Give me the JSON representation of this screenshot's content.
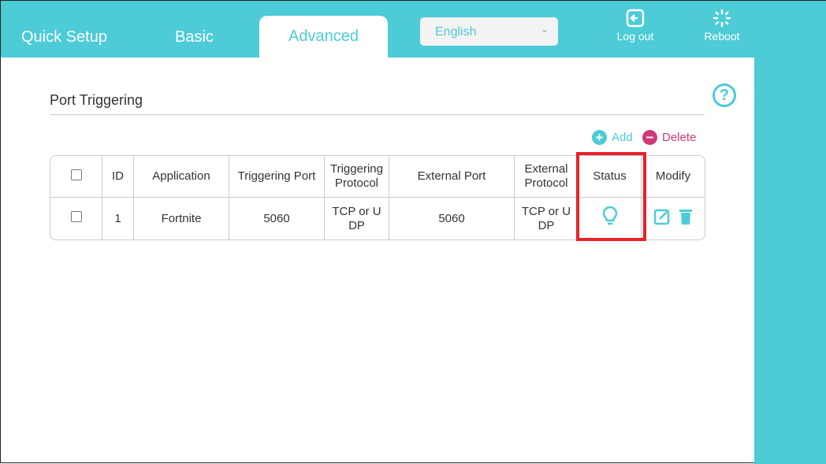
{
  "nav": {
    "quick_setup": "Quick Setup",
    "basic": "Basic",
    "advanced": "Advanced"
  },
  "language": {
    "selected": "English"
  },
  "tools": {
    "logout": "Log out",
    "reboot": "Reboot"
  },
  "page": {
    "title": "Port Triggering",
    "add": "Add",
    "delete": "Delete"
  },
  "table": {
    "headers": [
      "ID",
      "Application",
      "Triggering Port",
      "Triggering Protocol",
      "External Port",
      "External Protocol",
      "Status",
      "Modify"
    ],
    "rows": [
      {
        "id": "1",
        "application": "Fortnite",
        "triggering_port": "5060",
        "triggering_protocol": "TCP or UDP",
        "external_port": "5060",
        "external_protocol": "TCP or UDP",
        "status": "enabled"
      }
    ]
  },
  "colors": {
    "accent": "#4dcbd6",
    "delete": "#d0387a",
    "highlight": "#e8212a"
  }
}
